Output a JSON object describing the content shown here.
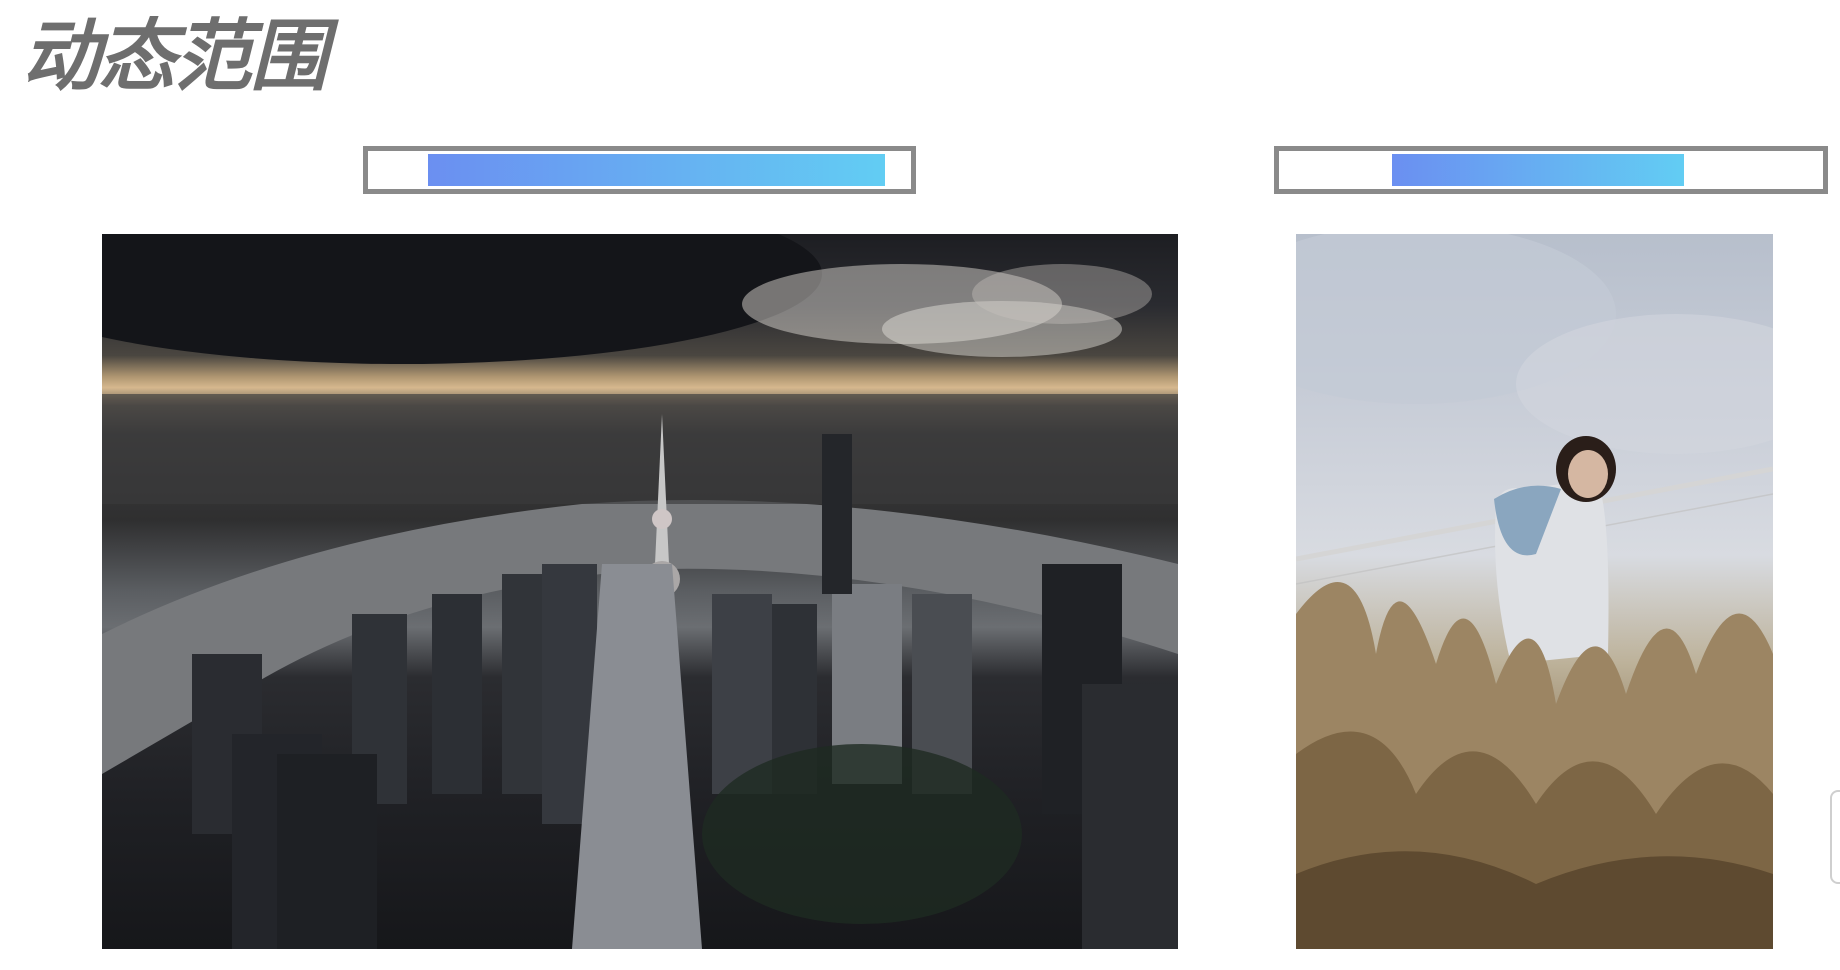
{
  "title": "动态范围",
  "range_bars": [
    {
      "id": "left",
      "fill_start_fraction": 0.11,
      "fill_end_fraction": 0.93,
      "gradient": [
        "#6b8ff1",
        "#62cdf3"
      ]
    },
    {
      "id": "right",
      "fill_start_fraction": 0.21,
      "fill_end_fraction": 0.74,
      "gradient": [
        "#6b8ff1",
        "#62cdf3"
      ]
    }
  ],
  "colors": {
    "title": "#6e6e6e",
    "bar_border": "#8a8a8a"
  }
}
